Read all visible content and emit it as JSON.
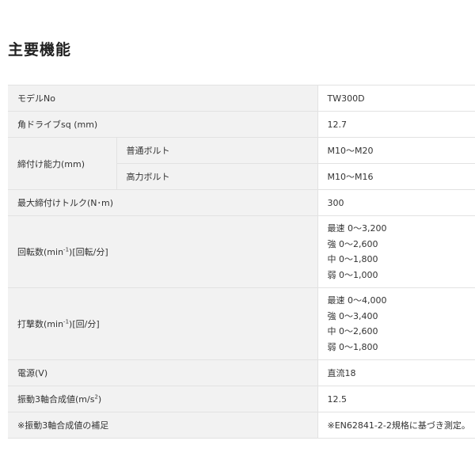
{
  "title": "主要機能",
  "rows": {
    "model": {
      "label": "モデルNo",
      "value": "TW300D"
    },
    "drive": {
      "label": "角ドライブsq (mm)",
      "value": "12.7"
    },
    "capacity": {
      "label": "締付け能力(mm)",
      "regular_label": "普通ボルト",
      "regular_value": "M10～M20",
      "high_label": "高力ボルト",
      "high_value": "M10～M16"
    },
    "torque": {
      "label": "最大締付けトルク(N･m)",
      "value": "300"
    },
    "rpm": {
      "label_pre": "回転数(min",
      "label_sup": "-1",
      "label_post": ")[回転/分]",
      "values": [
        "最速 0～3,200",
        "強 0～2,600",
        "中 0～1,800",
        "弱 0～1,000"
      ]
    },
    "ipm": {
      "label_pre": "打撃数(min",
      "label_sup": "-1",
      "label_post": ")[回/分]",
      "values": [
        "最速 0～4,000",
        "強 0～3,400",
        "中 0～2,600",
        "弱 0～1,800"
      ]
    },
    "power": {
      "label": "電源(V)",
      "value": "直流18"
    },
    "vibration": {
      "label_pre": "振動3軸合成値(m/s",
      "label_sup": "2",
      "label_post": ")",
      "value": "12.5"
    },
    "note": {
      "label": "※振動3軸合成値の補足",
      "value": "※EN62841-2-2規格に基づき測定。"
    }
  }
}
